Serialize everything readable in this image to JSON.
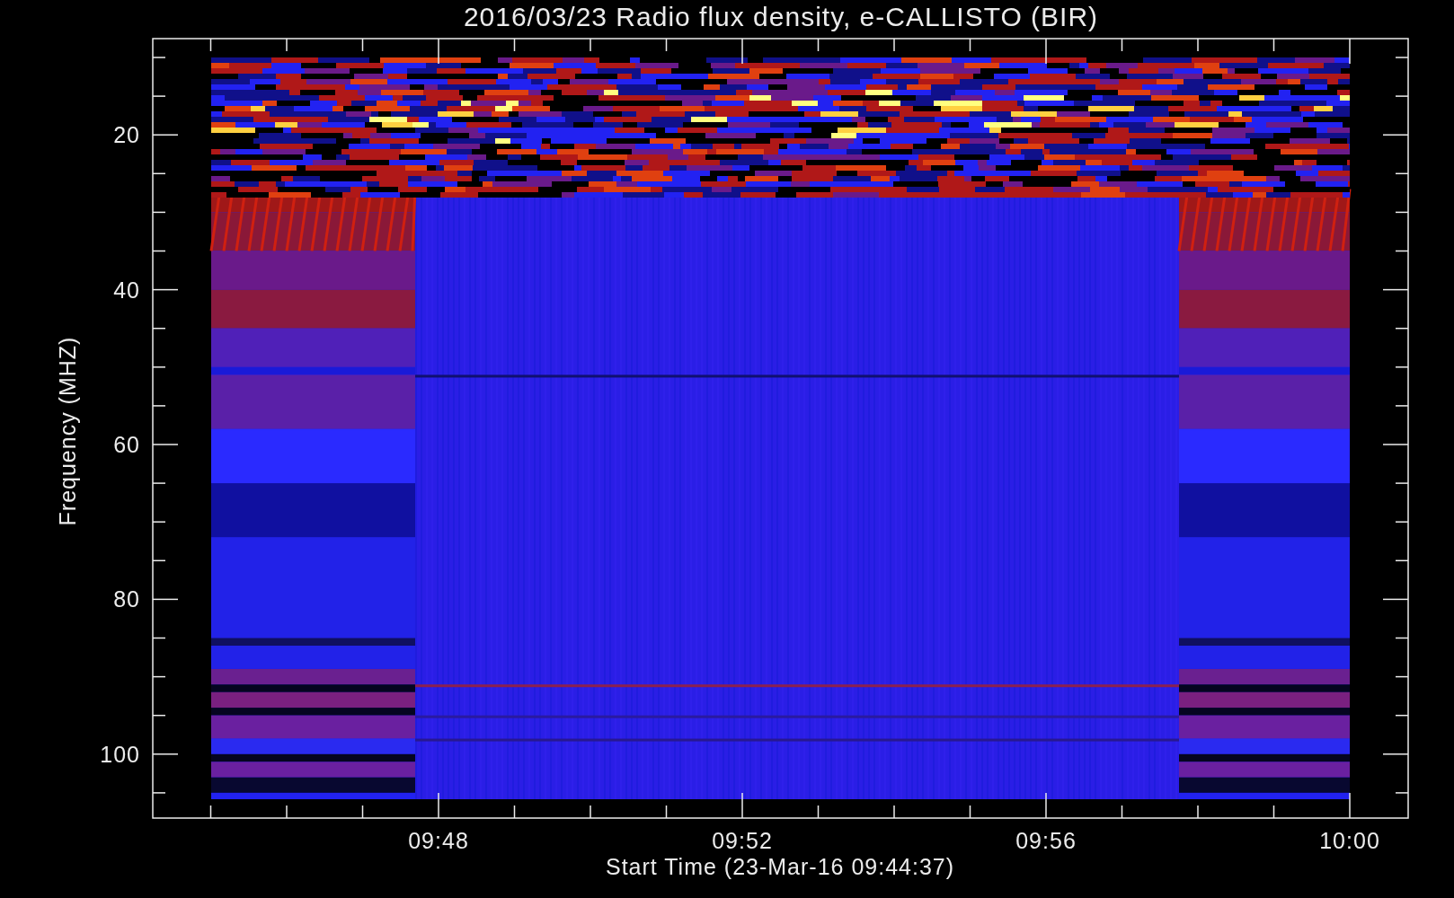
{
  "title": "2016/03/23  Radio flux density, e-CALLISTO (BIR)",
  "y_axis": {
    "label": "Frequency (MHZ)",
    "ticks": [
      "20",
      "40",
      "60",
      "80",
      "100"
    ]
  },
  "x_axis": {
    "label": "Start Time (23-Mar-16 09:44:37)",
    "ticks": [
      "09:48",
      "09:52",
      "09:56",
      "10:00"
    ]
  }
}
